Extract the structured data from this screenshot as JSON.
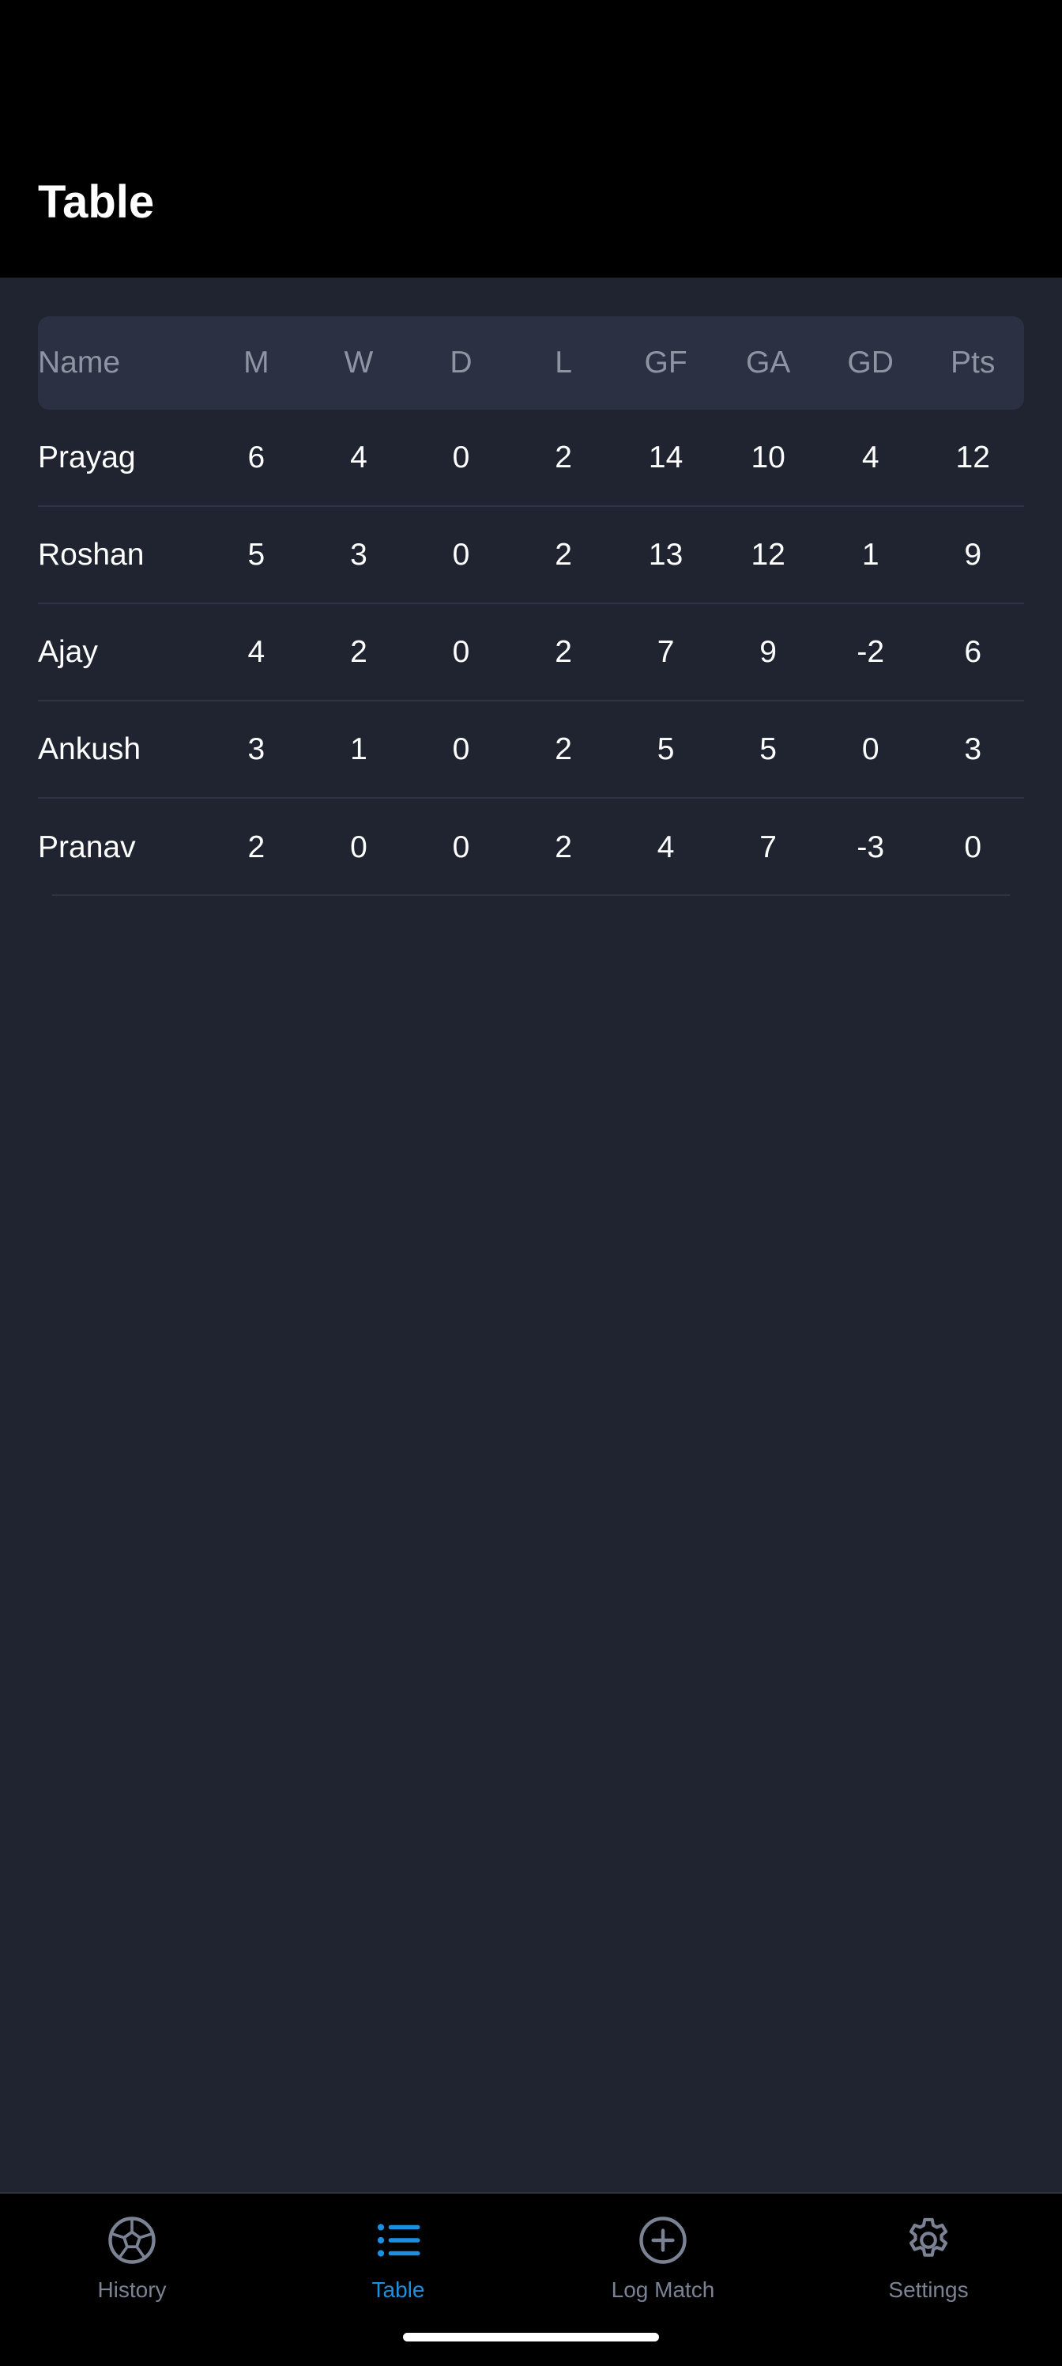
{
  "header": {
    "title": "Table"
  },
  "table": {
    "columns": [
      "Name",
      "M",
      "W",
      "D",
      "L",
      "GF",
      "GA",
      "GD",
      "Pts"
    ],
    "rows": [
      [
        "Prayag",
        "6",
        "4",
        "0",
        "2",
        "14",
        "10",
        "4",
        "12"
      ],
      [
        "Roshan",
        "5",
        "3",
        "0",
        "2",
        "13",
        "12",
        "1",
        "9"
      ],
      [
        "Ajay",
        "4",
        "2",
        "0",
        "2",
        "7",
        "9",
        "-2",
        "6"
      ],
      [
        "Ankush",
        "3",
        "1",
        "0",
        "2",
        "5",
        "5",
        "0",
        "3"
      ],
      [
        "Pranav",
        "2",
        "0",
        "0",
        "2",
        "4",
        "7",
        "-3",
        "0"
      ]
    ]
  },
  "nav": {
    "items": [
      {
        "label": "History",
        "icon": "soccer-ball-icon"
      },
      {
        "label": "Table",
        "icon": "list-icon",
        "active": true
      },
      {
        "label": "Log Match",
        "icon": "plus-circle-icon"
      },
      {
        "label": "Settings",
        "icon": "gear-icon"
      }
    ]
  },
  "colors": {
    "background": "#1f2430",
    "header": "#000000",
    "table_header": "#2b3142",
    "accent": "#1b8fe0",
    "inactive": "#7b8293"
  }
}
